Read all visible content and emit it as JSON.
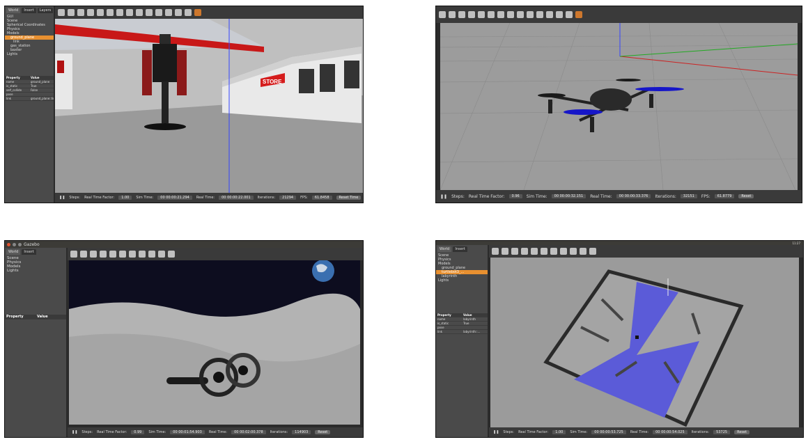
{
  "win1": {
    "tabs": [
      "World",
      "Insert",
      "Layers"
    ],
    "tree": [
      "GUI",
      "Scene",
      "Spherical Coordinates",
      "Physics",
      "Models",
      "ground_plane",
      "link",
      "gas_station",
      "baxter",
      "Lights"
    ],
    "prop_header": [
      "Property",
      "Value"
    ],
    "props": [
      [
        "name",
        "ground_plane"
      ],
      [
        "is_static",
        "True"
      ],
      [
        "self_collide",
        "False"
      ],
      [
        "pose",
        ""
      ],
      [
        "link",
        "ground_plane::link"
      ]
    ],
    "status": {
      "steps": "Steps:",
      "rtf_label": "Real Time Factor:",
      "rtf": "1.00",
      "sim_label": "Sim Time:",
      "sim": "00 00:00:21.294",
      "real_label": "Real Time:",
      "real": "00 00:00:22.001",
      "iter_label": "Iterations:",
      "iter": "21294",
      "fps_label": "FPS:",
      "fps": "61.8458",
      "reset": "Reset Time"
    },
    "store_sign": "STORE"
  },
  "win2": {
    "status": {
      "steps": "Steps:",
      "rtf_label": "Real Time Factor:",
      "rtf": "0.96",
      "sim_label": "Sim Time:",
      "sim": "00 00:00:32.151",
      "real_label": "Real Time:",
      "real": "00 00:00:33.376",
      "iter_label": "Iterations:",
      "iter": "32151",
      "fps_label": "FPS:",
      "fps": "61.8779",
      "reset": "Reset"
    }
  },
  "win3": {
    "title": "Gazebo",
    "tabs": [
      "World",
      "Insert"
    ],
    "tree": [
      "Scene",
      "Physics",
      "Models",
      "Lights"
    ],
    "prop_header": [
      "Property",
      "Value"
    ],
    "status": {
      "steps": "Steps:",
      "rtf_label": "Real Time Factor:",
      "rtf": "0.99",
      "sim_label": "Sim Time:",
      "sim": "00 00:01:54.903",
      "real_label": "Real Time:",
      "real": "00 00:02:00.378",
      "iter_label": "Iterations:",
      "iter": "114903",
      "reset": "Reset"
    }
  },
  "win4": {
    "tabs": [
      "World",
      "Insert"
    ],
    "tree": [
      "Scene",
      "Physics",
      "Models",
      "ground_plane",
      "turtlebot3_...",
      "labyrinth",
      "Lights"
    ],
    "prop_header": [
      "Property",
      "Value"
    ],
    "props": [
      [
        "name",
        "labyrinth"
      ],
      [
        "is_static",
        "True"
      ],
      [
        "pose",
        ""
      ],
      [
        "link",
        "labyrinth::..."
      ]
    ],
    "status": {
      "steps": "Steps:",
      "rtf_label": "Real Time Factor:",
      "rtf": "1.00",
      "sim_label": "Sim Time:",
      "sim": "00 00:00:53.725",
      "real_label": "Real Time:",
      "real": "00 00:00:54.025",
      "iter_label": "Iterations:",
      "iter": "53725",
      "reset": "Reset"
    },
    "clock": "11:27"
  }
}
